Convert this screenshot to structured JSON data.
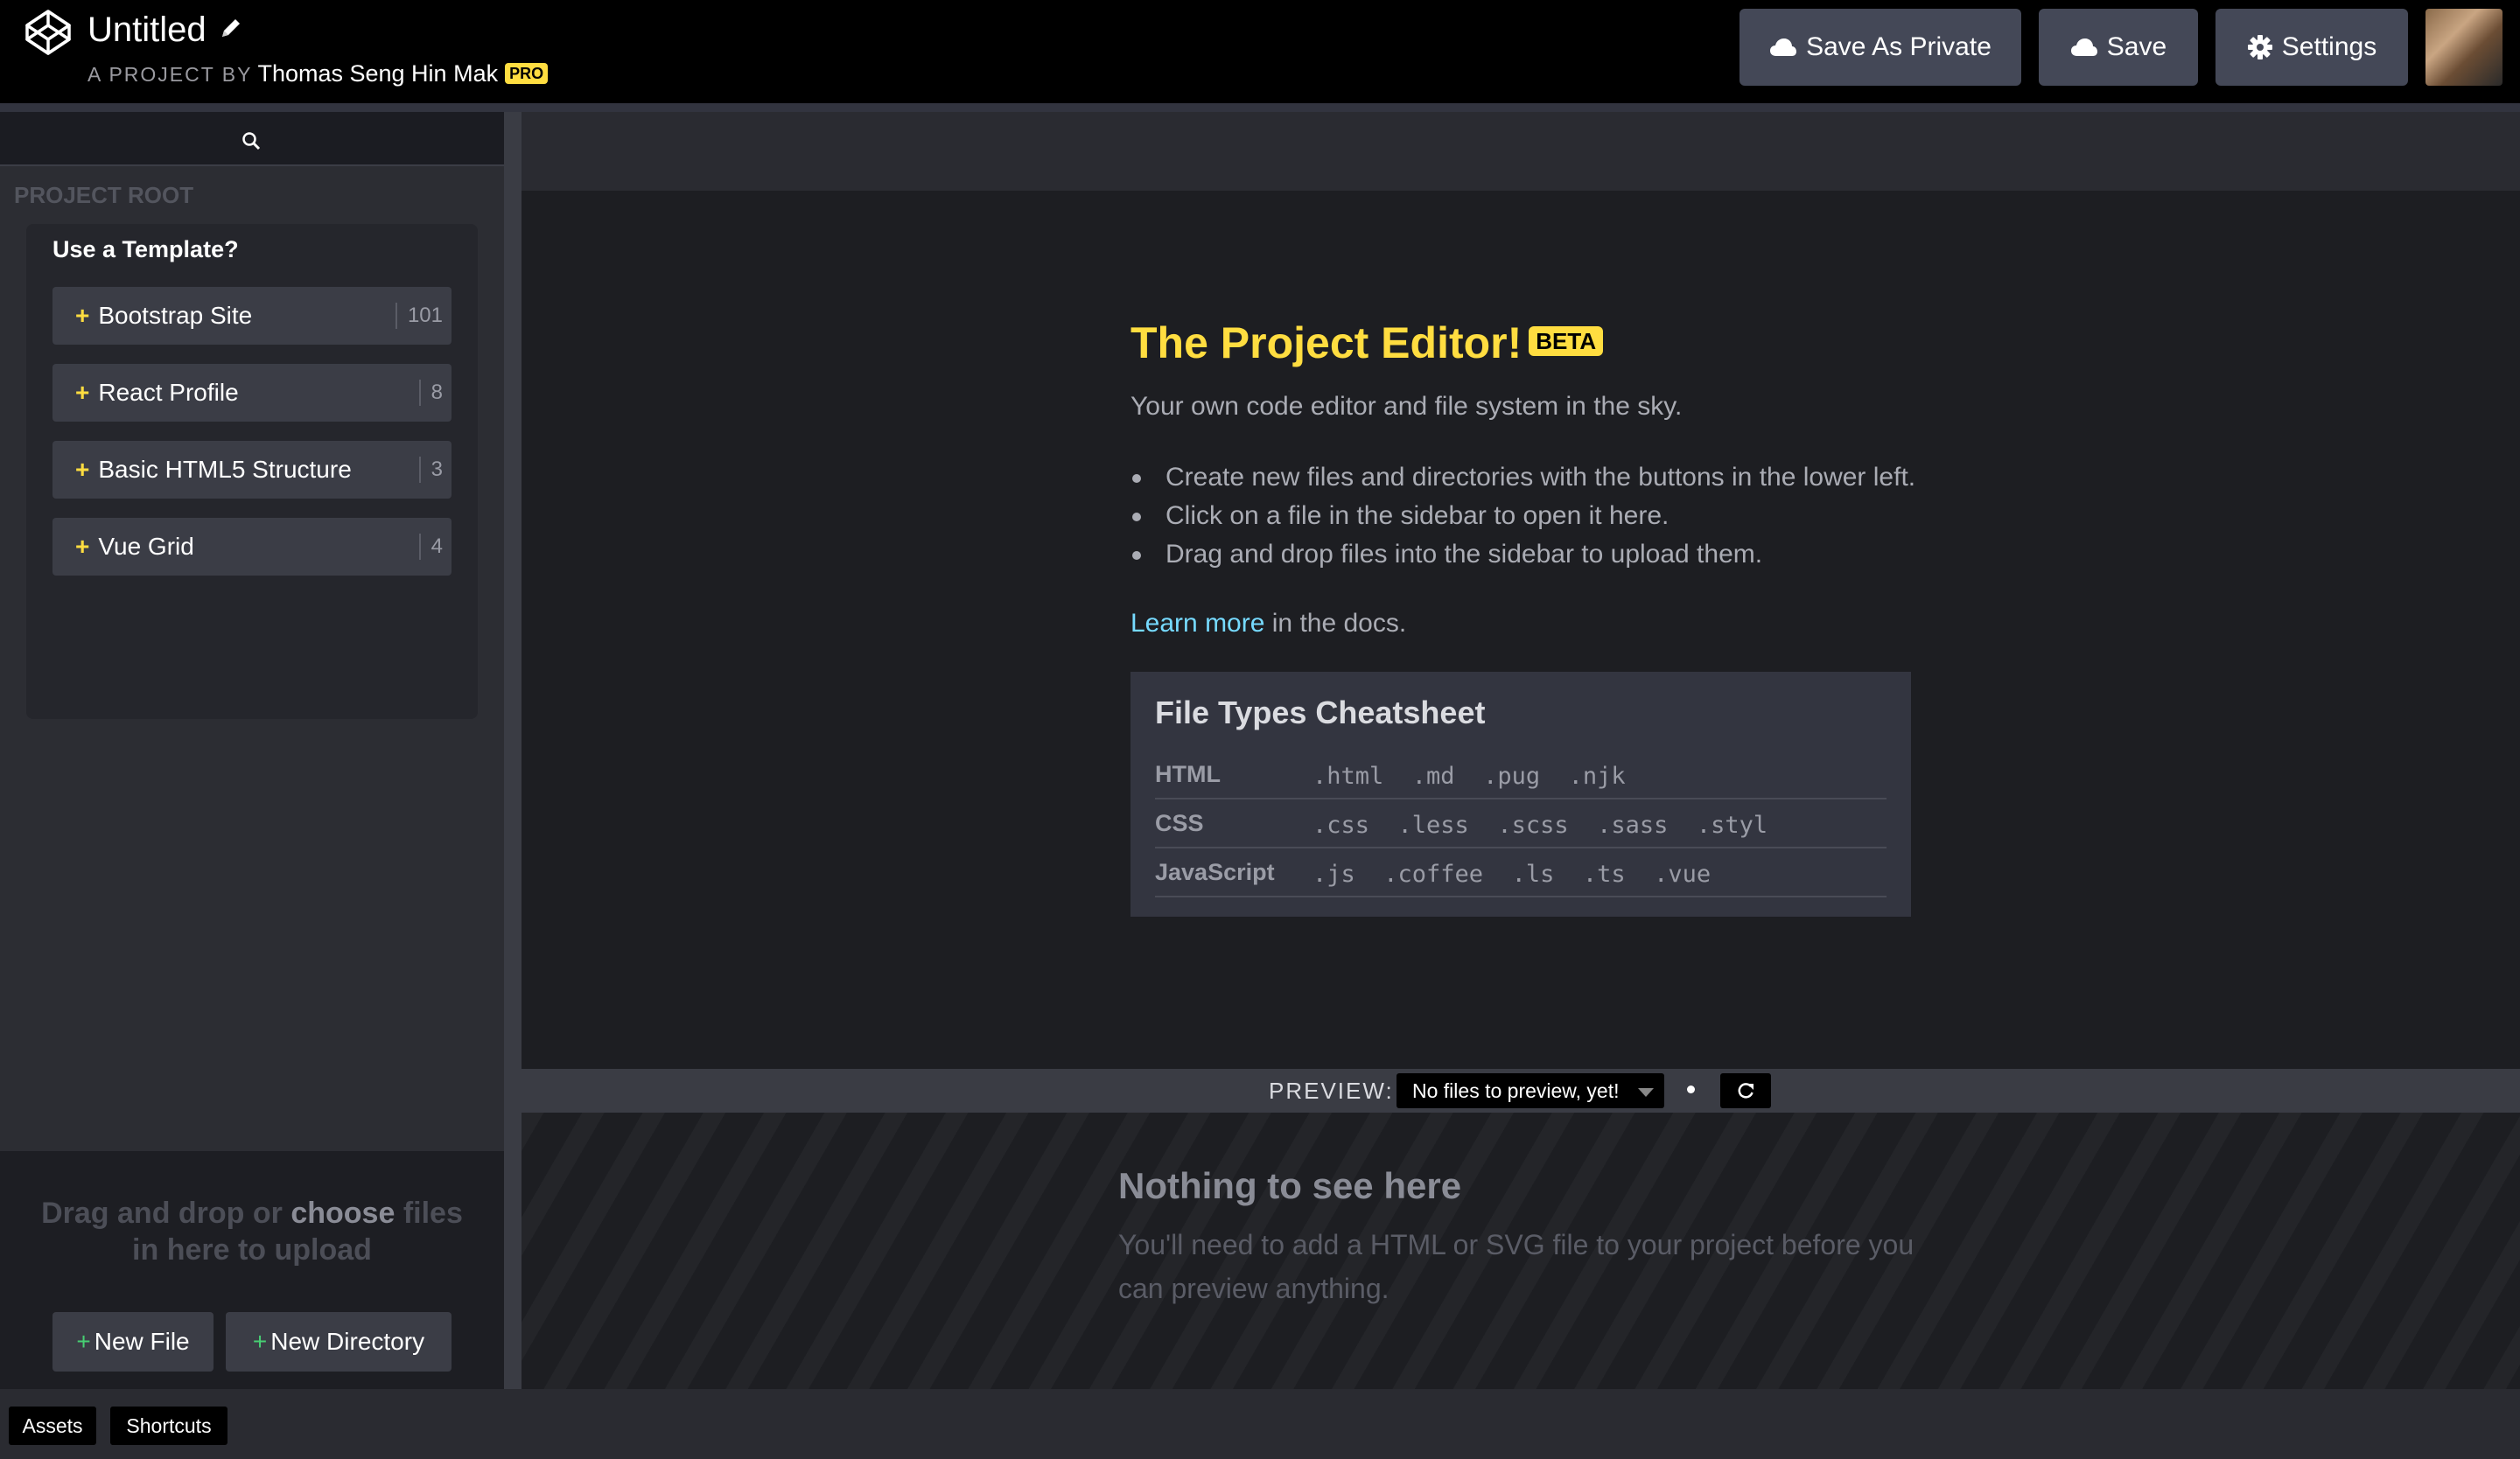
{
  "header": {
    "title": "Untitled",
    "byline_prefix": "A PROJECT BY",
    "owner": "Thomas Seng Hin Mak",
    "owner_badge": "PRO",
    "save_private_label": "Save As Private",
    "save_label": "Save",
    "settings_label": "Settings"
  },
  "sidebar": {
    "root_label": "PROJECT ROOT",
    "template_heading": "Use a Template?",
    "templates": [
      {
        "label": "Bootstrap Site",
        "count": "101"
      },
      {
        "label": "React Profile",
        "count": "8"
      },
      {
        "label": "Basic HTML5 Structure",
        "count": "3"
      },
      {
        "label": "Vue Grid",
        "count": "4"
      }
    ],
    "upload_pre": "Drag and drop or ",
    "upload_choose": "choose",
    "upload_post": " files",
    "upload_line2": "in here to upload",
    "new_file_label": "New File",
    "new_directory_label": "New Directory"
  },
  "editor": {
    "title": "The Project Editor!",
    "badge": "BETA",
    "subtitle": "Your own code editor and file system in the sky.",
    "bullets": [
      "Create new files and directories with the buttons in the lower left.",
      "Click on a file in the sidebar to open it here.",
      "Drag and drop files into the sidebar to upload them."
    ],
    "learn_link": "Learn more",
    "learn_rest": " in the docs.",
    "cheatsheet": {
      "title": "File Types Cheatsheet",
      "rows": [
        {
          "lang": "HTML",
          "exts": ".html  .md  .pug  .njk"
        },
        {
          "lang": "CSS",
          "exts": ".css  .less  .scss  .sass  .styl"
        },
        {
          "lang": "JavaScript",
          "exts": ".js  .coffee  .ls  .ts  .vue"
        }
      ]
    }
  },
  "preview": {
    "label": "PREVIEW:",
    "select_value": "No files to preview, yet!",
    "empty_title": "Nothing to see here",
    "empty_body": "You'll need to add a HTML or SVG file to your project before you can preview anything."
  },
  "footer": {
    "assets_label": "Assets",
    "shortcuts_label": "Shortcuts"
  },
  "colors": {
    "accent_yellow": "#ffdd40",
    "link_blue": "#76daff",
    "plus_green": "#47cf73"
  }
}
